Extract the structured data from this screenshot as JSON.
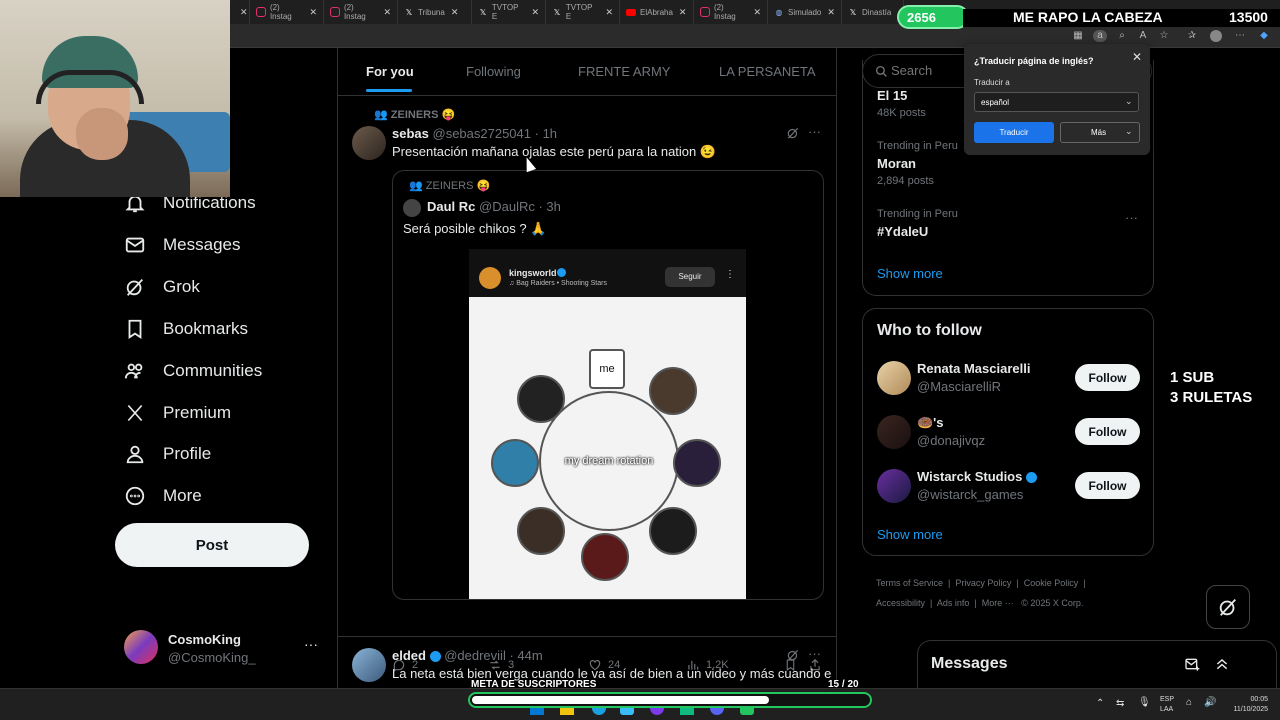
{
  "browser": {
    "tabs": [
      {
        "label": "",
        "icon": "x-icon",
        "color": "#ffffff"
      },
      {
        "label": "(2) Instag",
        "icon": "instagram-icon",
        "color": "#e1306c"
      },
      {
        "label": "(2) Instag",
        "icon": "instagram-icon",
        "color": "#e1306c"
      },
      {
        "label": "Tribuna",
        "icon": "x-icon",
        "color": "#ffffff"
      },
      {
        "label": "TVTOP E",
        "icon": "x-icon",
        "color": "#ffffff"
      },
      {
        "label": "TVTOP E",
        "icon": "x-icon",
        "color": "#ffffff"
      },
      {
        "label": "ElAbraha",
        "icon": "youtube-icon",
        "color": "#ff0000"
      },
      {
        "label": "(2) Instag",
        "icon": "instagram-icon",
        "color": "#e1306c"
      },
      {
        "label": "Simulado",
        "icon": "globe-icon",
        "color": "#8ab4f8"
      },
      {
        "label": "Dinastía",
        "icon": "x-icon",
        "color": "#ffffff"
      }
    ]
  },
  "stream": {
    "goal_count": "2656",
    "goal_title": "ME RAPO LA CABEZA",
    "goal_target": "13500",
    "sub_line1": "1 SUB",
    "sub_line2": "3 RULETAS",
    "meta_label": "META DE SUSCRIPTORES",
    "meta_count": "15",
    "meta_total": "/ 20",
    "meta_progress": 0.75
  },
  "nav": {
    "items": [
      {
        "label": "Notifications",
        "icon": "bell-icon"
      },
      {
        "label": "Messages",
        "icon": "mail-icon"
      },
      {
        "label": "Grok",
        "icon": "grok-icon"
      },
      {
        "label": "Bookmarks",
        "icon": "bookmark-icon"
      },
      {
        "label": "Communities",
        "icon": "communities-icon"
      },
      {
        "label": "Premium",
        "icon": "x-logo-icon"
      },
      {
        "label": "Profile",
        "icon": "person-icon"
      },
      {
        "label": "More",
        "icon": "more-circle-icon"
      }
    ],
    "post_label": "Post",
    "account": {
      "name": "CosmoKing",
      "handle": "@CosmoKing_"
    }
  },
  "feed": {
    "tabs": [
      "For you",
      "Following",
      "FRENTE ARMY",
      "LA PERSANETA"
    ],
    "post1": {
      "community": "ZEINERS 😝",
      "name": "sebas",
      "handle": "@sebas2725041",
      "time": "· 1h",
      "text": "Presentación mañana ojalas este perú para la nation 😉",
      "quote": {
        "community": "ZEINERS 😝",
        "name": "Daul Rc",
        "handle": "@DaulRc",
        "time": "· 3h",
        "text": "Será posible chikos ? 🙏",
        "media": {
          "account": "kingsworld",
          "song": "♫ Bag Raiders • Shooting Stars",
          "follow": "Seguir",
          "me_label": "me",
          "center_label": "my dream rotation"
        }
      },
      "stats": {
        "replies": "2",
        "reposts": "3",
        "likes": "24",
        "views": "1.2K"
      }
    },
    "post2": {
      "name": "elded",
      "handle": "@dedreviil",
      "time": "· 44m",
      "text": "La neta está bien verga cuando le va así de bien a un video y más cuando es"
    }
  },
  "right": {
    "search_placeholder": "Search",
    "trends": [
      {
        "context": "",
        "title": "El 15",
        "posts": "48K posts"
      },
      {
        "context": "Trending in Peru",
        "title": "Moran",
        "posts": "2,894 posts"
      },
      {
        "context": "Trending in Peru",
        "title": "#YdaleU",
        "posts": ""
      }
    ],
    "show_more": "Show more",
    "who_to_follow": {
      "title": "Who to follow",
      "users": [
        {
          "name": "Renata Masciarelli",
          "handle": "@MasciarelliR"
        },
        {
          "name": "🍩's",
          "handle": "@donajivqz"
        },
        {
          "name": "Wistarck Studios",
          "handle": "@wistarck_games"
        }
      ],
      "follow_label": "Follow",
      "show_more": "Show more"
    },
    "footer": {
      "links": [
        "Terms of Service",
        "Privacy Policy",
        "Cookie Policy",
        "Accessibility",
        "Ads info",
        "More ···",
        "© 2025 X Corp."
      ]
    },
    "messages_label": "Messages"
  },
  "translate": {
    "title": "¿Traducir página de inglés?",
    "label": "Traducir a",
    "selected": "español",
    "translate_button": "Traducir",
    "more_button": "Más"
  },
  "taskbar": {
    "lang1": "ESP",
    "lang2": "LAA",
    "time": "00:05",
    "date": "11/10/2025"
  },
  "colors": {
    "accent": "#1d9bf0",
    "goal_green": "#22c55e",
    "progress_green": "#16a34a"
  }
}
